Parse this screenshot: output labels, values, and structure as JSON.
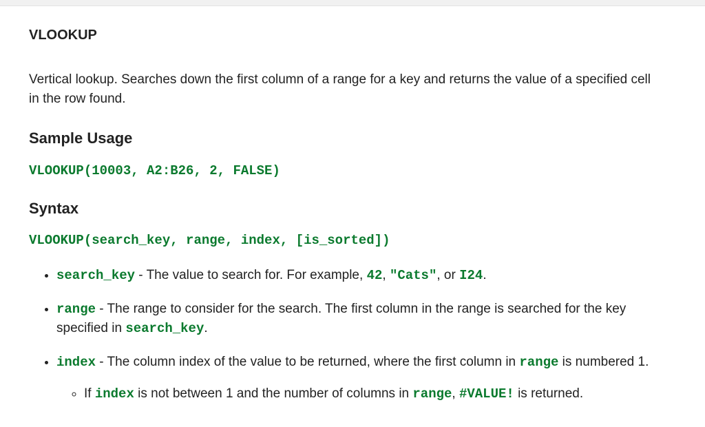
{
  "title": "VLOOKUP",
  "description": "Vertical lookup. Searches down the first column of a range for a key and returns the value of a specified cell in the row found.",
  "sections": {
    "sample_usage": {
      "heading": "Sample Usage",
      "code": "VLOOKUP(10003, A2:B26, 2, FALSE)"
    },
    "syntax": {
      "heading": "Syntax",
      "signature": "VLOOKUP(search_key, range, index, [is_sorted])",
      "params": {
        "search_key": {
          "name": "search_key",
          "desc_prefix": " - The value to search for. For example, ",
          "ex1": "42",
          "sep1": ", ",
          "ex2": "\"Cats\"",
          "sep2": ", or ",
          "ex3": "I24",
          "suffix": "."
        },
        "range": {
          "name": "range",
          "desc_prefix": " - The range to consider for the search. The first column in the range is searched for the key specified in ",
          "ref": "search_key",
          "suffix": "."
        },
        "index": {
          "name": "index",
          "desc_prefix": " - The column index of the value to be returned, where the first column in ",
          "ref": "range",
          "desc_suffix": " is numbered 1.",
          "sub": {
            "pre": "If ",
            "c1": "index",
            "mid1": " is not between 1 and the number of columns in ",
            "c2": "range",
            "mid2": ", ",
            "c3": "#VALUE!",
            "post": " is returned."
          }
        }
      }
    }
  }
}
